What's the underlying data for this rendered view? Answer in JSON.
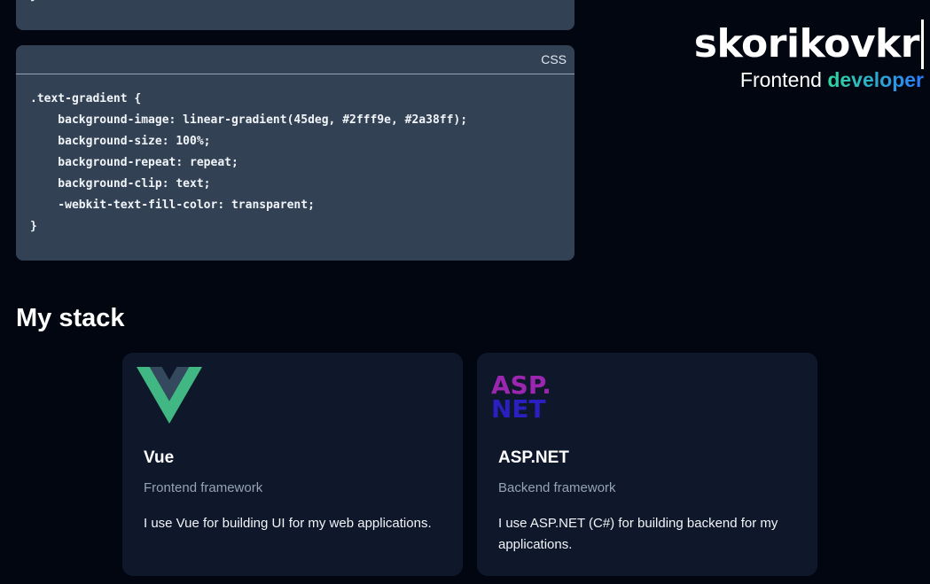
{
  "code_top": {
    "last_line": "}"
  },
  "code_block": {
    "language": "CSS",
    "lines": [
      ".text-gradient {",
      "    background-image: linear-gradient(45deg, #2fff9e, #2a38ff);",
      "    background-size: 100%;",
      "    background-repeat: repeat;",
      "    background-clip: text;",
      "    -webkit-text-fill-color: transparent;",
      "}"
    ]
  },
  "brand": {
    "name": "skorikovkr",
    "subtitle_plain": "Frontend",
    "subtitle_accent": "developer"
  },
  "stack": {
    "title": "My stack",
    "cards": [
      {
        "title": "Vue",
        "subtitle": "Frontend framework",
        "description": "I use Vue for building UI for my web applications.",
        "logo": "vue-logo"
      },
      {
        "title": "ASP.NET",
        "subtitle": "Backend framework",
        "description": "I use ASP.NET (C#) for building backend for my applications.",
        "logo": "aspnet-logo",
        "logo_text_top": "ASP.",
        "logo_text_bottom": "NET"
      }
    ]
  },
  "colors": {
    "background": "#020610",
    "code_background": "#334155",
    "card_background": "#0f172a",
    "vue_green": "#41b883",
    "vue_dark": "#35495e",
    "asp_purple": "#9b27b0",
    "asp_blue": "#2a1fbf",
    "gradient_start": "#2fd89e",
    "gradient_end": "#2a7bff"
  }
}
